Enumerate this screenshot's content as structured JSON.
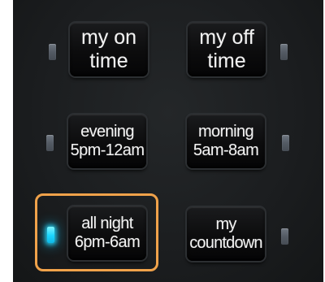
{
  "buttons": {
    "my_on_time": {
      "line1": "my on",
      "line2": "time"
    },
    "my_off_time": {
      "line1": "my off",
      "line2": "time"
    },
    "evening": {
      "line1": "evening",
      "line2": "5pm-12am"
    },
    "morning": {
      "line1": "morning",
      "line2": "5am-8am"
    },
    "all_night": {
      "line1": "all night",
      "line2": "6pm-6am",
      "selected": true
    },
    "my_countdown": {
      "line1": "my",
      "line2": "countdown"
    }
  },
  "indicators": {
    "my_on_time": "off",
    "my_off_time": "off",
    "evening": "off",
    "morning": "off",
    "all_night": "on",
    "my_countdown": "off"
  },
  "colors": {
    "panel": "#1f2224",
    "button_face": "#0c0c0d",
    "text": "#f2f2f2",
    "led_off": "#5b626b",
    "led_on": "#1bd6ff",
    "highlight": "#f0a24a"
  }
}
